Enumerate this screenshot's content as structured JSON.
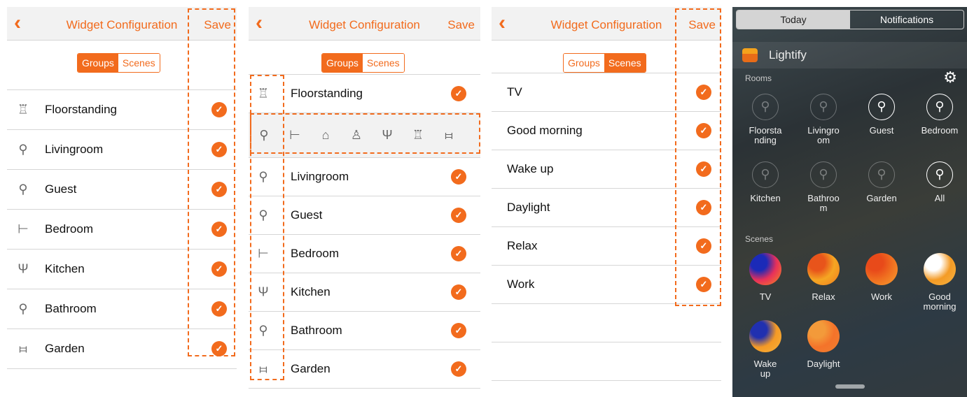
{
  "config": {
    "back_glyph": "‹",
    "title": "Widget Configuration",
    "save_label": "Save",
    "seg_groups": "Groups",
    "seg_scenes": "Scenes",
    "check_glyph": "✓",
    "accent_color": "#f26b1d"
  },
  "groups": [
    {
      "label": "Floorstanding",
      "icon": "floor-lamp-icon",
      "glyph": "♖"
    },
    {
      "label": "Livingroom",
      "icon": "bulb-icon",
      "glyph": "⚲"
    },
    {
      "label": "Guest",
      "icon": "bulb-icon",
      "glyph": "⚲"
    },
    {
      "label": "Bedroom",
      "icon": "bed-icon",
      "glyph": "⊢"
    },
    {
      "label": "Kitchen",
      "icon": "fork-knife-icon",
      "glyph": "Ψ"
    },
    {
      "label": "Bathroom",
      "icon": "bulb-icon",
      "glyph": "⚲"
    },
    {
      "label": "Garden",
      "icon": "fence-icon",
      "glyph": "⧦"
    }
  ],
  "icon_picker": [
    {
      "icon": "bulb-icon",
      "glyph": "⚲"
    },
    {
      "icon": "bed-icon",
      "glyph": "⊢"
    },
    {
      "icon": "house-icon",
      "glyph": "⌂"
    },
    {
      "icon": "child-icon",
      "glyph": "♙"
    },
    {
      "icon": "fork-knife-icon",
      "glyph": "Ψ"
    },
    {
      "icon": "floor-lamp-icon",
      "glyph": "♖"
    },
    {
      "icon": "fence-icon",
      "glyph": "⧦"
    }
  ],
  "scenes_list": [
    "TV",
    "Good morning",
    "Wake up",
    "Daylight",
    "Relax",
    "Work"
  ],
  "widget": {
    "tab_today": "Today",
    "tab_notifications": "Notifications",
    "app_name": "Lightify",
    "rooms_label": "Rooms",
    "scenes_label": "Scenes",
    "gear_glyph": "⚙",
    "bulb_glyph": "⚲",
    "rooms": [
      {
        "label": "Floorsta\nnding",
        "on": false
      },
      {
        "label": "Livingro\nom",
        "on": false
      },
      {
        "label": "Guest",
        "on": true
      },
      {
        "label": "Bedroom",
        "on": true
      },
      {
        "label": "Kitchen",
        "on": false
      },
      {
        "label": "Bathroo\nm",
        "on": false
      },
      {
        "label": "Garden",
        "on": false
      },
      {
        "label": "All",
        "on": true
      }
    ],
    "scenes": [
      {
        "label": "TV",
        "colors": [
          "#e8305a",
          "#1b2ab8",
          "#f28c1e"
        ]
      },
      {
        "label": "Relax",
        "colors": [
          "#f5a623",
          "#e8541b",
          "#f07a1e"
        ]
      },
      {
        "label": "Work",
        "colors": [
          "#f07020",
          "#e84a1a",
          "#f6a030"
        ]
      },
      {
        "label": "Good\nmorning",
        "colors": [
          "#f49b25",
          "#ffffff",
          "#f7b445"
        ]
      },
      {
        "label": "Wake\nup",
        "colors": [
          "#f59a25",
          "#2030b0",
          "#f6b23c"
        ]
      },
      {
        "label": "Daylight",
        "colors": [
          "#f4732a",
          "#f39a3a",
          "#f08030"
        ]
      }
    ]
  }
}
